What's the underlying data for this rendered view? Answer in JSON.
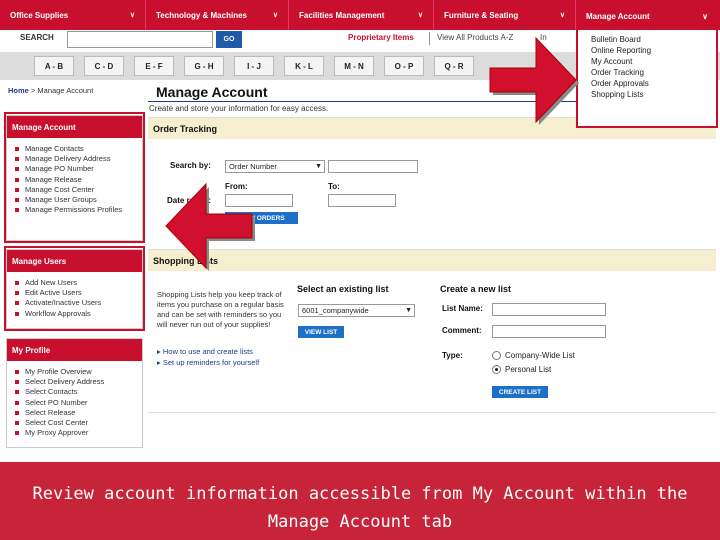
{
  "topnav": [
    {
      "label": "Office Supplies"
    },
    {
      "label": "Technology & Machines"
    },
    {
      "label": "Facilities Management"
    },
    {
      "label": "Furniture & Seating"
    }
  ],
  "search": {
    "label": "SEARCH",
    "go": "GO",
    "proprietary": "Proprietary Items",
    "view_all": "View All Products A-Z",
    "truncated": "In"
  },
  "alpha": [
    "A - B",
    "C - D",
    "E - F",
    "G - H",
    "I - J",
    "K - L",
    "M - N",
    "O - P",
    "Q - R"
  ],
  "breadcrumb": {
    "home": "Home",
    "sep": ">",
    "current": "Manage Account"
  },
  "page": {
    "title": "Manage Account",
    "subtitle": "Create and store your information for easy access."
  },
  "sidebar": {
    "manage_account": {
      "title": "Manage Account",
      "items": [
        "Manage Contacts",
        "Manage Delivery Address",
        "Manage PO Number",
        "Manage Release",
        "Manage Cost Center",
        "Manage User Groups",
        "Manage Permissions Profiles"
      ]
    },
    "manage_users": {
      "title": "Manage Users",
      "items": [
        "Add New Users",
        "Edit Active Users",
        "Activate/Inactive Users",
        "Workflow Approvals"
      ]
    },
    "my_profile": {
      "title": "My Profile",
      "items": [
        "My Profile Overview",
        "Select Delivery Address",
        "Select Contacts",
        "Select PO Number",
        "Select Release",
        "Select Cost Center",
        "My Proxy Approver"
      ]
    }
  },
  "order_tracking": {
    "title": "Order Tracking",
    "search_by": "Search by:",
    "search_by_value": "Order Number",
    "date_range": "Date range:",
    "from": "From:",
    "to": "To:",
    "button": "VIEW ORDERS"
  },
  "shopping_lists": {
    "title": "Shopping Lists",
    "description": "Shopping Lists help you keep track of items you purchase on a regular basis and can be set with reminders so you will never run out of your supplies!",
    "link_howto": "How to use and create lists",
    "link_reminders": "Set up reminders for yourself",
    "existing_title": "Select an existing list",
    "existing_value": "6001_companywide",
    "view_button": "VIEW LIST",
    "new_title": "Create a new list",
    "list_name": "List Name:",
    "comment": "Comment:",
    "type": "Type:",
    "type_company": "Company-Wide List",
    "type_personal": "Personal List",
    "create_button": "CREATE LIST"
  },
  "dropdown": {
    "title": "Manage Account",
    "items": [
      "Bulletin Board",
      "Online Reporting",
      "My Account",
      "Order Tracking",
      "Order Approvals",
      "Shopping Lists"
    ]
  },
  "caption": {
    "line1": "Review account information accessible from My Account within the",
    "line2": "Manage Account tab"
  },
  "colors": {
    "brand_red": "#c8102e",
    "link_blue": "#1e3c8a",
    "button_blue": "#1e6fc8",
    "section_bg": "#f5efcf"
  }
}
